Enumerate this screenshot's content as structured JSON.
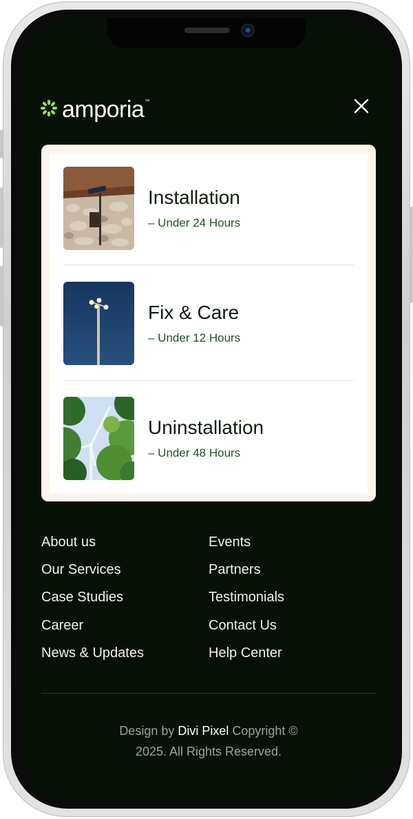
{
  "header": {
    "logo_text": "amporia",
    "logo_tm": "™",
    "close_symbol": "✕"
  },
  "services": [
    {
      "title": "Installation",
      "subtitle": "– Under 24 Hours",
      "image": "thatched-wall-lamp-photo"
    },
    {
      "title": "Fix & Care",
      "subtitle": "– Under 12 Hours",
      "image": "street-light-pole-photo"
    },
    {
      "title": "Uninstallation",
      "subtitle": "– Under 48 Hours",
      "image": "wind-turbine-trees-photo"
    }
  ],
  "nav": {
    "left": [
      "About us",
      "Our Services",
      "Case Studies",
      "Career",
      "News & Updates"
    ],
    "right": [
      "Events",
      "Partners",
      "Testimonials",
      "Contact Us",
      "Help Center"
    ]
  },
  "footer": {
    "prefix": "Design by ",
    "brand": "Divi Pixel",
    "suffix_line1": " Copyright ©",
    "line2": "2025. All Rights Reserved."
  },
  "colors": {
    "screen_bg": "#061006",
    "accent_green": "#1f5222",
    "logo_green": "#8fe04a",
    "card_border": "#fdf5ec"
  }
}
